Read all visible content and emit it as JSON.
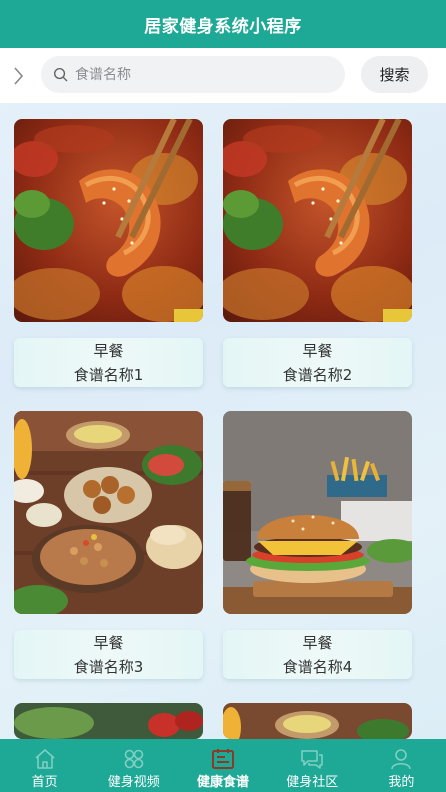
{
  "header": {
    "title": "居家健身系统小程序"
  },
  "search": {
    "placeholder": "食谱名称",
    "button_label": "搜索"
  },
  "recipes": [
    {
      "category": "早餐",
      "name": "食谱名称1",
      "image": "spicy-shrimp-photo"
    },
    {
      "category": "早餐",
      "name": "食谱名称2",
      "image": "spicy-shrimp-photo"
    },
    {
      "category": "早餐",
      "name": "食谱名称3",
      "image": "mezze-platter-photo"
    },
    {
      "category": "早餐",
      "name": "食谱名称4",
      "image": "burger-fries-photo"
    }
  ],
  "nav": {
    "items": [
      {
        "label": "首页",
        "icon": "home-icon",
        "active": false
      },
      {
        "label": "健身视频",
        "icon": "grid-flower-icon",
        "active": false
      },
      {
        "label": "健康食谱",
        "icon": "recipe-board-icon",
        "active": true
      },
      {
        "label": "健身社区",
        "icon": "chat-icon",
        "active": false
      },
      {
        "label": "我的",
        "icon": "user-icon",
        "active": false
      }
    ]
  },
  "colors": {
    "primary": "#1ea896",
    "active_icon": "#8b3a2a",
    "inactive_icon": "#7fcfc3"
  }
}
